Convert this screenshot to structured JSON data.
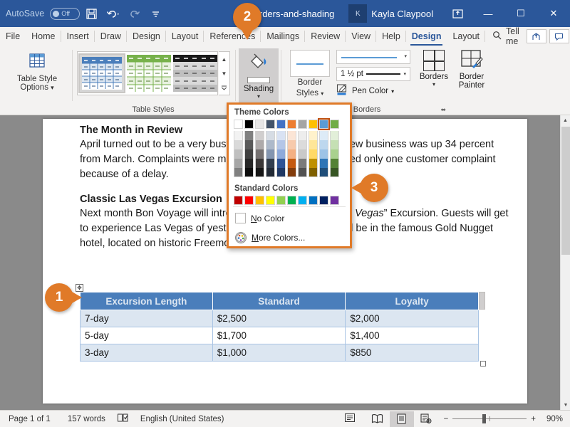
{
  "titlebar": {
    "autosave_label": "AutoSave",
    "autosave_state": "Off",
    "save_icon": "save-icon",
    "undo_icon": "undo-icon",
    "redo_icon": "redo-icon",
    "customize_icon": "customize-quick-access-icon",
    "document_title": "05-borders-and-shading",
    "avatar_initials": "K",
    "user_name": "Kayla Claypool",
    "ribbon_display_icon": "ribbon-display-options-icon",
    "minimize_label": "—",
    "maximize_label": "☐",
    "close_label": "✕",
    "bg_color": "#2b579a"
  },
  "tabs": [
    {
      "label": "File"
    },
    {
      "label": "Home"
    },
    {
      "label": "Insert"
    },
    {
      "label": "Draw"
    },
    {
      "label": "Design"
    },
    {
      "label": "Layout"
    },
    {
      "label": "References"
    },
    {
      "label": "Mailings"
    },
    {
      "label": "Review"
    },
    {
      "label": "View"
    },
    {
      "label": "Help"
    },
    {
      "label": "Design",
      "active": true
    },
    {
      "label": "Layout"
    }
  ],
  "tellme": {
    "icon": "search-icon",
    "label": "Tell me"
  },
  "tabbar_right": {
    "share_icon": "share-icon",
    "comments_icon": "comments-icon"
  },
  "ribbon": {
    "table_style_options": {
      "icon": "table-grid-icon",
      "label_line1": "Table Style",
      "label_line2": "Options",
      "dropdown_caret": "▾",
      "group_label": "Table Style Options"
    },
    "table_styles": {
      "group_label": "Table Styles",
      "styles": [
        {
          "name": "blue-table-style",
          "accent": "#4a7ebb",
          "band": "#dce6f1",
          "selected": true
        },
        {
          "name": "green-table-style",
          "accent": "#77b14b",
          "band": "#e9f2e0",
          "selected": false
        },
        {
          "name": "black-table-style",
          "accent": "#1a1a1a",
          "band": "#d9d9d9",
          "selected": false
        }
      ],
      "scroll_up": "▲",
      "scroll_down": "▼",
      "more": "▾"
    },
    "shading": {
      "icon": "paint-bucket-icon",
      "label": "Shading",
      "caret": "▾",
      "active": true
    },
    "borders_group": {
      "group_label": "Borders",
      "border_styles": {
        "icon": "border-style-icon",
        "label_line1": "Border",
        "label_line2": "Styles",
        "caret": "▾"
      },
      "line_style": {
        "value": "",
        "caret": "▾",
        "name": "line-style-dropdown"
      },
      "line_weight": {
        "value": "1 ½ pt",
        "caret": "▾"
      },
      "pen_color": {
        "icon": "pen-color-icon",
        "label": "Pen Color",
        "caret": "▾"
      },
      "borders": {
        "icon": "borders-grid-icon",
        "label": "Borders",
        "caret": "▾"
      },
      "border_painter": {
        "icon": "border-painter-icon",
        "label_line1": "Border",
        "label_line2": "Painter"
      },
      "dialog_launcher": "⬌"
    }
  },
  "shading_dropdown": {
    "theme_colors_label": "Theme Colors",
    "standard_colors_label": "Standard Colors",
    "selected_swatch_index": 8,
    "highlight_color": "#e07a28",
    "theme_columns": [
      {
        "name": "white",
        "shades": [
          "#ffffff",
          "#f2f2f2",
          "#d9d9d9",
          "#bfbfbf",
          "#a6a6a6",
          "#808080"
        ]
      },
      {
        "name": "black",
        "shades": [
          "#000000",
          "#808080",
          "#595959",
          "#404040",
          "#262626",
          "#0d0d0d"
        ]
      },
      {
        "name": "light-gray",
        "shades": [
          "#e7e6e6",
          "#d0cece",
          "#aeaaaa",
          "#757171",
          "#3b3838",
          "#161616"
        ]
      },
      {
        "name": "dark-blue-gray",
        "shades": [
          "#44546a",
          "#d6dce4",
          "#adb9ca",
          "#8496b0",
          "#333f4f",
          "#222a35"
        ]
      },
      {
        "name": "blue",
        "shades": [
          "#4472c4",
          "#d9e2f3",
          "#b4c6e7",
          "#8eaadb",
          "#2f5496",
          "#1f3864"
        ]
      },
      {
        "name": "orange",
        "shades": [
          "#ed7d31",
          "#fbe5d6",
          "#f7caac",
          "#f4b083",
          "#c55a11",
          "#833c0c"
        ]
      },
      {
        "name": "gray",
        "shades": [
          "#a5a5a5",
          "#ededed",
          "#dbdbdb",
          "#c9c9c9",
          "#7b7b7b",
          "#525252"
        ]
      },
      {
        "name": "gold",
        "shades": [
          "#ffc000",
          "#fff2cc",
          "#ffe699",
          "#ffd966",
          "#bf9000",
          "#7f6000"
        ]
      },
      {
        "name": "light-blue",
        "shades": [
          "#5b9bd5",
          "#ddebf7",
          "#bdd7ee",
          "#9dc3e6",
          "#2e75b6",
          "#1f4e79"
        ]
      },
      {
        "name": "green",
        "shades": [
          "#70ad47",
          "#e2efd9",
          "#c5e0b4",
          "#a9d18e",
          "#548235",
          "#375623"
        ]
      }
    ],
    "standard_colors": [
      {
        "name": "dark-red",
        "hex": "#c00000"
      },
      {
        "name": "red",
        "hex": "#ff0000"
      },
      {
        "name": "orange",
        "hex": "#ffc000"
      },
      {
        "name": "yellow",
        "hex": "#ffff00"
      },
      {
        "name": "light-green",
        "hex": "#92d050"
      },
      {
        "name": "green",
        "hex": "#00b050"
      },
      {
        "name": "light-blue",
        "hex": "#00b0f0"
      },
      {
        "name": "blue",
        "hex": "#0070c0"
      },
      {
        "name": "dark-blue",
        "hex": "#002060"
      },
      {
        "name": "purple",
        "hex": "#7030a0"
      }
    ],
    "no_color_label": "No Color",
    "more_colors_label": "More Colors...",
    "more_colors_icon": "color-palette-icon"
  },
  "document": {
    "heading1": "The Month in Review",
    "paragraph1": "April turned out to be a very busy month for Bon Voyage. New business was up 34 percent from March. Complaints were minimal—Bon Voyage received only one customer complaint because of a delay.",
    "heading2": "Classic Las Vegas Excursion",
    "paragraph2_before": "Next month Bon Voyage will introduce the new “",
    "paragraph2_italic": "Classic Las Vegas",
    "paragraph2_after": "” Excursion. Guests will get to experience Las Vegas of yesterday. Accommodations will be in the famous Gold Nugget hotel, located on historic Freemont Street.",
    "table": {
      "headers": [
        "Excursion Length",
        "Standard",
        "Loyalty"
      ],
      "rows": [
        [
          "7-day",
          "$2,500",
          "$2,000"
        ],
        [
          "5-day",
          "$1,700",
          "$1,400"
        ],
        [
          "3-day",
          "$1,000",
          "$850"
        ]
      ],
      "header_bg": "#4a7ebb",
      "band_bg": "#dce6f1",
      "move_handle_icon": "table-move-handle-icon",
      "resize_handle_icon": "table-resize-handle-icon"
    }
  },
  "callouts": [
    {
      "number": "1",
      "name": "callout-badge-1"
    },
    {
      "number": "2",
      "name": "callout-badge-2"
    },
    {
      "number": "3",
      "name": "callout-badge-3"
    }
  ],
  "scrollbar": {
    "up": "▲",
    "down": "▼"
  },
  "statusbar": {
    "page": "Page 1 of 1",
    "words": "157 words",
    "proofing_icon": "proofing-errors-icon",
    "language": "English (United States)",
    "accessibility_icon": "accessibility-checker-icon",
    "view_read_icon": "read-mode-icon",
    "view_print_icon": "print-layout-icon",
    "view_web_icon": "web-layout-icon",
    "zoom_out": "−",
    "zoom_in": "+",
    "zoom_value": "90%"
  }
}
